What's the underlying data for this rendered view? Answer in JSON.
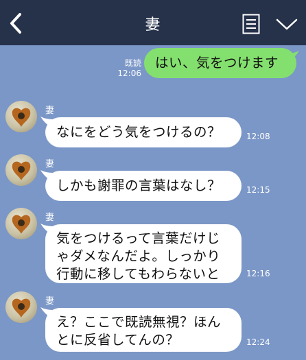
{
  "header": {
    "title": "妻"
  },
  "icons": {
    "back": "chevron-left-icon",
    "menu": "notes-icon",
    "expand": "chevron-down-icon"
  },
  "colors": {
    "header_bg": "#26314a",
    "chat_bg": "#7b97c7",
    "my_bubble": "#84e06e",
    "their_bubble": "#ffffff"
  },
  "messages": [
    {
      "sender": "me",
      "read_label": "既読",
      "time": "12:06",
      "text": "はい、気をつけます"
    },
    {
      "sender": "妻",
      "time": "12:08",
      "text": "なにをどう気をつけるの？"
    },
    {
      "sender": "妻",
      "time": "12:15",
      "text": "しかも謝罪の言葉はなし？"
    },
    {
      "sender": "妻",
      "time": "12:16",
      "lines": [
        "気をつけるって言葉だけじ",
        "ゃダメなんだよ。しっかり",
        "行動に移してもわらないと"
      ]
    },
    {
      "sender": "妻",
      "time": "12:24",
      "lines": [
        "え？ここで既読無視？ほん",
        "とに反省してんの？"
      ]
    }
  ]
}
